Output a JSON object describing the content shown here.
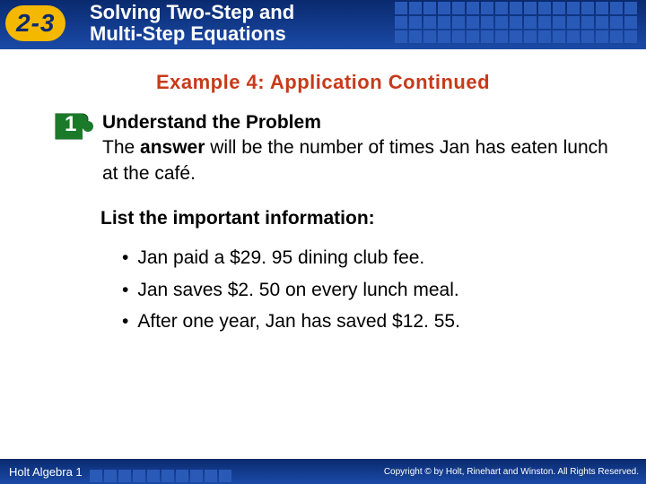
{
  "header": {
    "lesson_number": "2-3",
    "title_line1": "Solving Two-Step and",
    "title_line2": "Multi-Step Equations"
  },
  "content": {
    "example_heading": "Example 4: Application Continued",
    "step_number": "1",
    "step_title": "Understand the Problem",
    "step_body_pre": "The ",
    "step_body_bold": "answer",
    "step_body_post": " will be the number of times Jan has eaten lunch at the café.",
    "list_heading": "List the important information:",
    "bullets": [
      "Jan paid a $29. 95 dining club fee.",
      "Jan saves $2. 50 on every lunch meal.",
      "After one year, Jan has saved $12. 55."
    ]
  },
  "footer": {
    "left": "Holt Algebra 1",
    "right": "Copyright © by Holt, Rinehart and Winston. All Rights Reserved."
  }
}
